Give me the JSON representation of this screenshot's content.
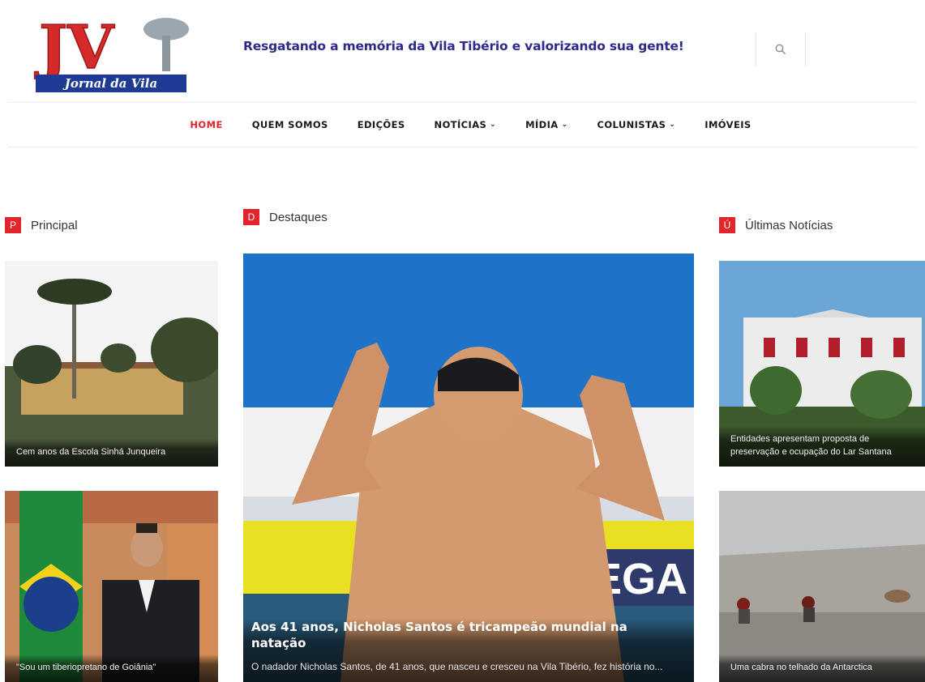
{
  "header": {
    "logo_text": "JV",
    "logo_subtitle": "Jornal da Vila",
    "tagline": "Resgatando a memória da Vila Tibério e valorizando sua gente!",
    "search_icon": "search-icon"
  },
  "nav": {
    "items": [
      {
        "label": "HOME",
        "active": true
      },
      {
        "label": "QUEM SOMOS"
      },
      {
        "label": "EDIÇÕES"
      },
      {
        "label": "NOTÍCIAS",
        "dropdown": true
      },
      {
        "label": "MÍDIA",
        "dropdown": true
      },
      {
        "label": "COLUNISTAS",
        "dropdown": true
      },
      {
        "label": "IMÓVEIS"
      }
    ],
    "caret": "⌄"
  },
  "sections": {
    "principal": {
      "badge": "P",
      "title": "Principal"
    },
    "destaques": {
      "badge": "D",
      "title": "Destaques"
    },
    "ultimas": {
      "badge": "Ú",
      "title": "Últimas Notícias"
    }
  },
  "principal_posts": [
    {
      "caption": "Cem anos da Escola Sinhá Junqueira"
    },
    {
      "caption": "\"Sou um tiberiopretano de Goiânia\""
    }
  ],
  "featured": {
    "title": "Aos 41 anos, Nicholas Santos é tricampeão mundial na natação",
    "excerpt": "O nadador Nicholas Santos, de 41 anos, que nasceu e cresceu na Vila Tibério, fez história no...",
    "banner_text": "OMEGA"
  },
  "ultimas_posts": [
    {
      "caption": "Entidades apresentam proposta de preservação e ocupação do Lar Santana"
    },
    {
      "caption": "Uma cabra no telhado da Antarctica"
    }
  ],
  "colors": {
    "accent": "#e3242b",
    "tagline": "#2d2a8c",
    "logo_blue": "#1f3a93"
  }
}
